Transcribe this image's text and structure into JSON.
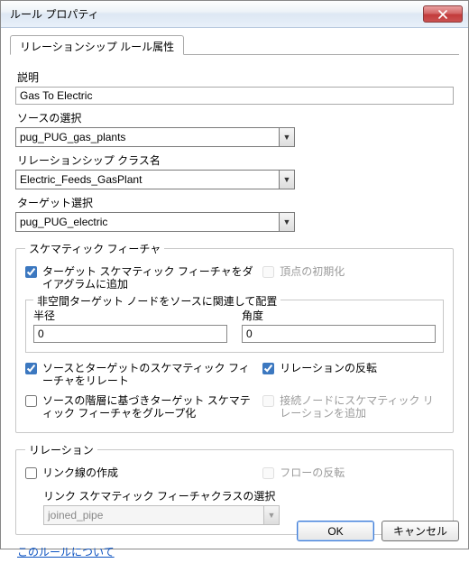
{
  "window": {
    "title": "ルール プロパティ",
    "close_tooltip": "閉じる"
  },
  "tab": {
    "label": "リレーションシップ ルール属性"
  },
  "fields": {
    "description_label": "説明",
    "description_value": "Gas To Electric",
    "source_label": "ソースの選択",
    "source_value": "pug_PUG_gas_plants",
    "relclass_label": "リレーションシップ クラス名",
    "relclass_value": "Electric_Feeds_GasPlant",
    "target_label": "ターゲット選択",
    "target_value": "pug_PUG_electric"
  },
  "schematic": {
    "legend": "スケマティック フィーチャ",
    "add_target": {
      "checked": true,
      "label": "ターゲット スケマティック フィーチャをダイアグラムに追加"
    },
    "init_vertex": {
      "checked": false,
      "label": "頂点の初期化",
      "disabled": true
    },
    "sub_legend": "非空間ターゲット ノードをソースに関連して配置",
    "radius_label": "半径",
    "radius_value": "0",
    "angle_label": "角度",
    "angle_value": "0",
    "relate": {
      "checked": true,
      "label": "ソースとターゲットのスケマティック フィーチャをリレート"
    },
    "reverse_relation": {
      "checked": true,
      "label": "リレーションの反転"
    },
    "group_by_src": {
      "checked": false,
      "label": "ソースの階層に基づきターゲット スケマティック フィーチャをグループ化"
    },
    "add_conn_node": {
      "checked": false,
      "label": "接続ノードにスケマティック リレーションを追加",
      "disabled": true
    }
  },
  "relation": {
    "legend": "リレーション",
    "make_link": {
      "checked": false,
      "label": "リンク線の作成"
    },
    "reverse_flow": {
      "checked": false,
      "label": "フローの反転",
      "disabled": true
    },
    "linkclass_label": "リンク スケマティック フィーチャクラスの選択",
    "linkclass_value": "joined_pipe"
  },
  "help_link": "このルールについて",
  "buttons": {
    "ok": "OK",
    "cancel": "キャンセル"
  }
}
